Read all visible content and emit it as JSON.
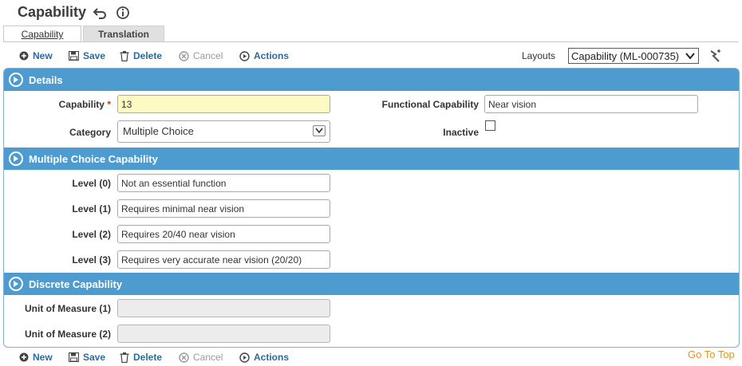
{
  "header": {
    "title": "Capability"
  },
  "tabs": [
    {
      "label": "Capability",
      "active": true
    },
    {
      "label": "Translation",
      "active": false
    }
  ],
  "toolbar": {
    "new_label": "New",
    "save_label": "Save",
    "delete_label": "Delete",
    "cancel_label": "Cancel",
    "actions_label": "Actions"
  },
  "layouts": {
    "label": "Layouts",
    "selected": "Capability (ML-000735)"
  },
  "sections": {
    "details": {
      "title": "Details",
      "capability_label": "Capability",
      "capability_value": "13",
      "functional_label": "Functional Capability",
      "functional_value": "Near vision",
      "category_label": "Category",
      "category_value": "Multiple Choice",
      "inactive_label": "Inactive",
      "inactive_checked": false
    },
    "multiple_choice": {
      "title": "Multiple Choice Capability",
      "levels": [
        {
          "label": "Level (0)",
          "value": "Not an essential function"
        },
        {
          "label": "Level (1)",
          "value": "Requires minimal near vision"
        },
        {
          "label": "Level (2)",
          "value": "Requires 20/40 near vision"
        },
        {
          "label": "Level (3)",
          "value": "Requires very accurate near vision (20/20)"
        }
      ]
    },
    "discrete": {
      "title": "Discrete Capability",
      "uom1_label": "Unit of Measure (1)",
      "uom1_value": "",
      "uom2_label": "Unit of Measure (2)",
      "uom2_value": ""
    }
  },
  "footer": {
    "go_top": "Go To Top"
  },
  "colors": {
    "accent": "#4e9bd0",
    "link": "#2d6aa0",
    "required_bg": "#fdfbc3",
    "go_top": "#e0952b"
  },
  "icons": {
    "undo": "undo-arrow-icon",
    "info": "info-icon",
    "new": "plus-circle-icon",
    "save": "floppy-disk-icon",
    "delete": "trash-icon",
    "cancel": "x-circle-icon",
    "actions": "play-circle-icon",
    "layout_tool": "wand-icon"
  }
}
